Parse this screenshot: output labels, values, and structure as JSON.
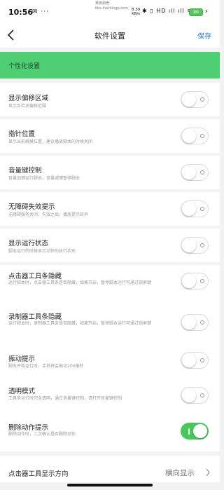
{
  "status_bar": {
    "time": "10:56",
    "notification_icons": "✉ ···",
    "watermark_line1": "果核剥壳",
    "watermark_line2": "bbs.ihackingp.com",
    "speed_value": "8.39",
    "speed_unit": "KB/s",
    "signal_icons": "✱ ▯ HD ıll ıll ≋",
    "battery": "90"
  },
  "nav": {
    "title": "软件设置",
    "save_label": "保存",
    "back_icon": "chevron-left-icon"
  },
  "banner": {
    "label": "个性化设置",
    "color": "#4fcf74"
  },
  "settings": [
    {
      "title": "显示偏移区域",
      "desc": "显示反检测偏移范围",
      "enabled": false
    },
    {
      "title": "指针位置",
      "desc": "显示当前触摸位置，建议播放脚本的时候关闭",
      "enabled": false
    },
    {
      "title": "音量键控制",
      "desc": "音量加键运行脚本，音量减键暂停脚本",
      "enabled": false
    },
    {
      "title": "无障碍失效提示",
      "desc": "无障碍服务关闭，失效之后，播放提示铃声",
      "enabled": false
    },
    {
      "title": "显示运行状态",
      "desc": "脚本运行的时候显示动作的执行状态",
      "enabled": false
    },
    {
      "title": "点击器工具条隐藏",
      "desc": "运行脚本时，点击器工具条是否隐藏，如果开启，暂停脚本运行可通过锁屏键",
      "enabled": false
    },
    {
      "title": "录制器工具条隐藏",
      "desc": "运行脚本时，录制器工具条是否隐藏，如果开启，暂停脚本运行可通过锁屏键",
      "enabled": false
    },
    {
      "title": "振动提示",
      "desc": "脚本开始运行时，手机将会振动200毫秒",
      "enabled": false
    },
    {
      "title": "透明模式",
      "desc": "工具条运行时完全透明，通过音量键控制，请打开音量键控制",
      "enabled": false
    },
    {
      "title": "删除动作提示",
      "desc": "删除动作时，二次确认是否删除动作",
      "enabled": true
    }
  ],
  "select_row": {
    "title": "点击器工具显示方向",
    "value": "横向显示",
    "chevron_icon": "chevron-right-icon"
  },
  "colors": {
    "toggle_on": "#48c85c",
    "link": "#2a7ad6"
  }
}
